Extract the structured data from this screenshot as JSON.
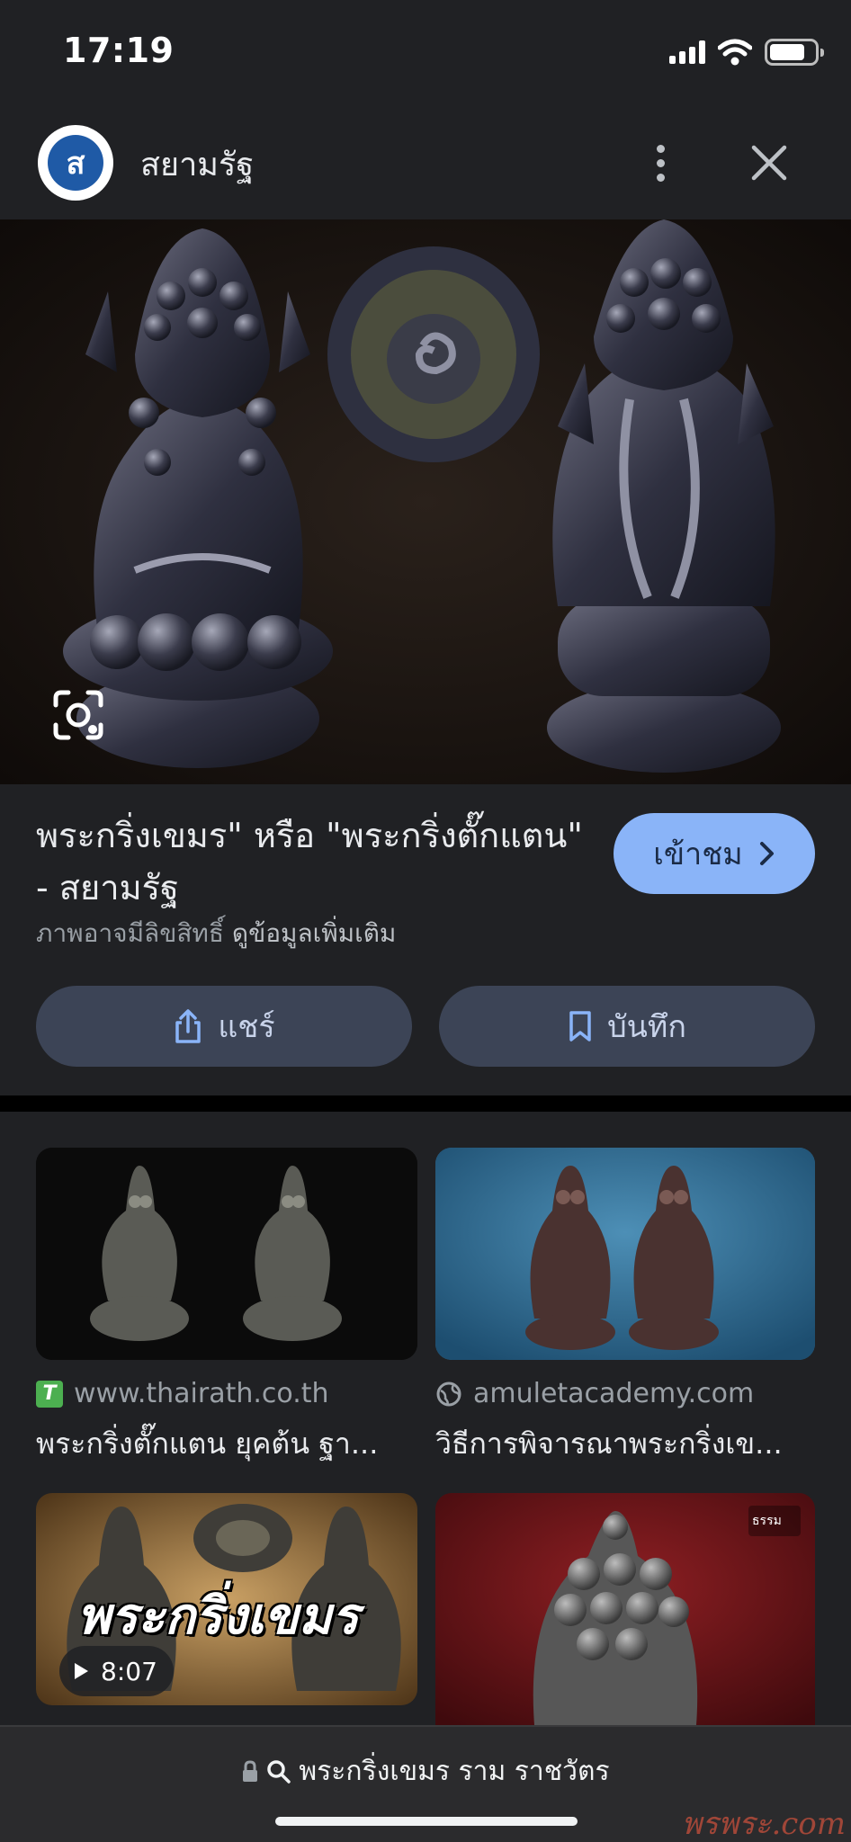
{
  "status_bar": {
    "time": "17:19",
    "battery_level": 0.8
  },
  "header": {
    "site_initial": "ส",
    "site_name": "สยามรัฐ"
  },
  "result": {
    "title": "พระกริ่งเขมร\" หรือ \"พระกริ่งตั๊กแตน\" - สยามรัฐ",
    "visit_label": "เข้าชม",
    "copyright_text": "ภาพอาจมีลิขสิทธิ์",
    "more_info_link": "ดูข้อมูลเพิ่มเติม",
    "share_label": "แชร์",
    "save_label": "บันทึก"
  },
  "related": [
    {
      "source": "www.thairath.co.th",
      "source_icon": "thairath-logo",
      "title": "พระกริ่งตั๊กแตน ยุคต้น ฐา..."
    },
    {
      "source": "amuletacademy.com",
      "source_icon": "globe-icon",
      "title": "วิธีการพิจารณาพระกริ่งเข..."
    },
    {
      "overlay_text": "พระกริ่งเขมร",
      "video_duration": "8:07"
    },
    {
      "overlay_text": "ธรรม"
    }
  ],
  "url_bar": {
    "query": "พระกริ่งเขมร ราม ราชวัตร"
  },
  "watermark": "พรพระ.com",
  "colors": {
    "accent": "#8ab4f8",
    "background": "#202124",
    "chip": "#3c4456"
  }
}
